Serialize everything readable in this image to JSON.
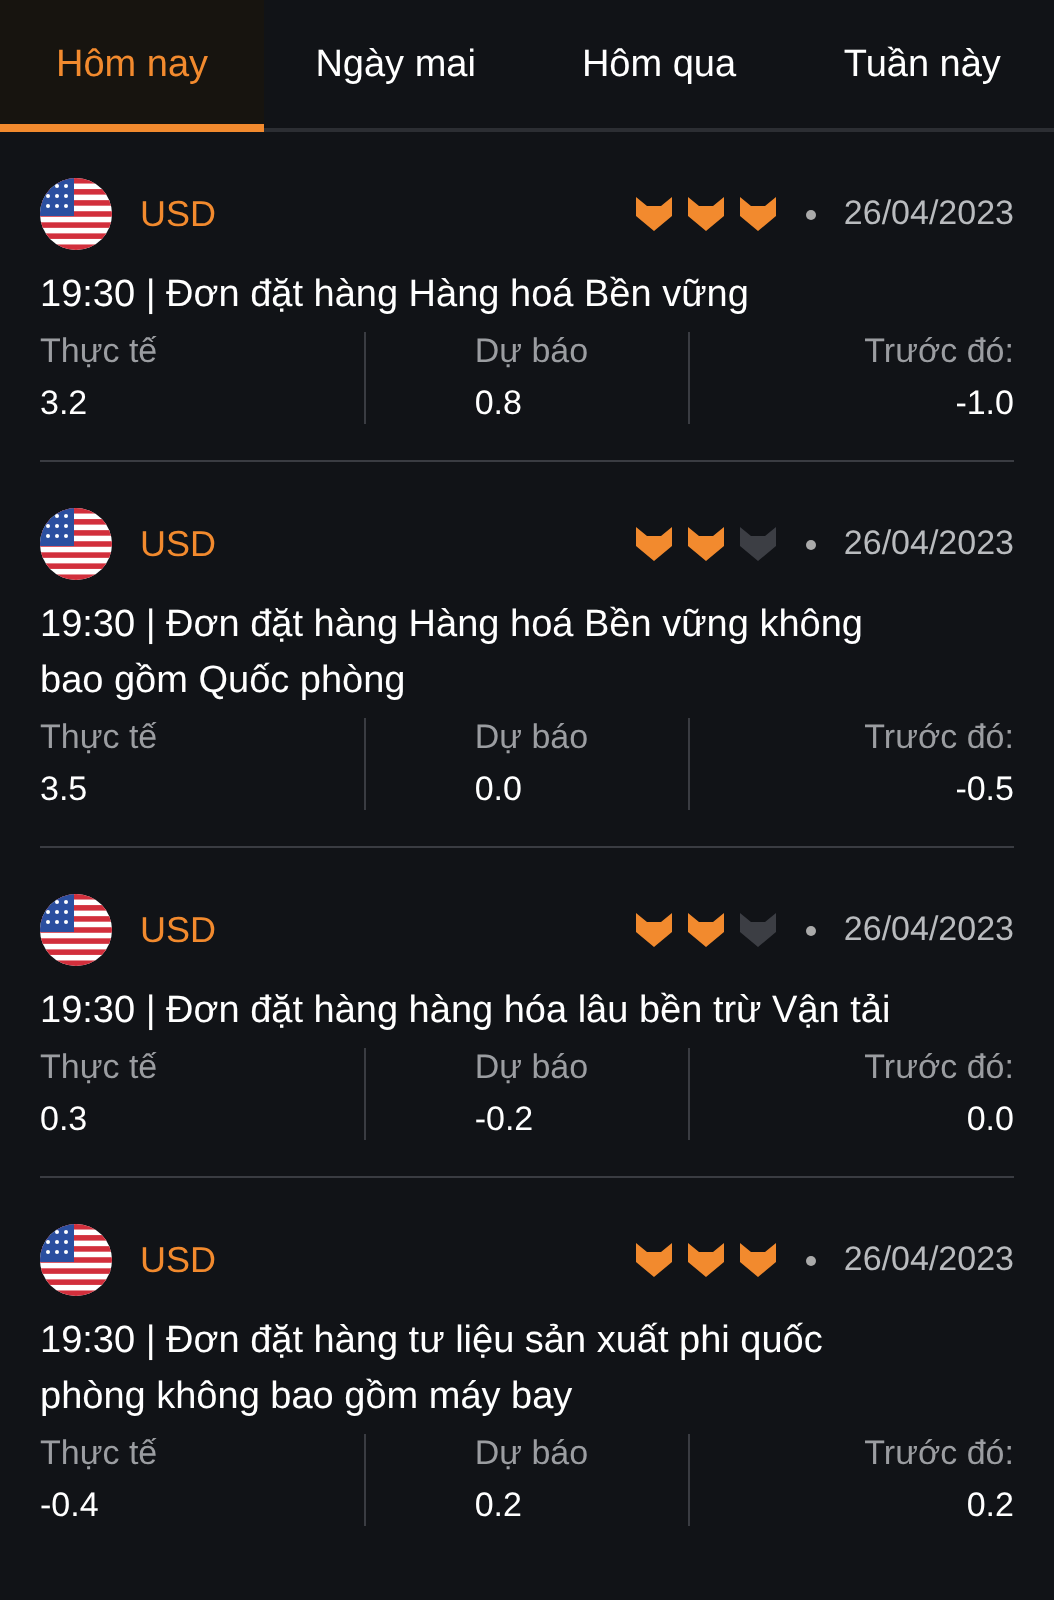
{
  "tabs": [
    {
      "label": "Hôm nay",
      "selected": true
    },
    {
      "label": "Ngày mai",
      "selected": false
    },
    {
      "label": "Hôm qua",
      "selected": false
    },
    {
      "label": "Tuần này",
      "selected": false
    }
  ],
  "events": [
    {
      "currency": "USD",
      "stars": 3,
      "date": "26/04/2023",
      "title": "19:30 | Đơn đặt hàng Hàng hoá Bền vững",
      "stats": [
        {
          "label": "Thực tế",
          "value": "3.2"
        },
        {
          "label": "Dự báo",
          "value": "0.8"
        },
        {
          "label": "Trước đó:",
          "value": "-1.0"
        }
      ]
    },
    {
      "currency": "USD",
      "stars": 2,
      "date": "26/04/2023",
      "title": "19:30 | Đơn đặt hàng Hàng hoá Bền vững không bao gồm Quốc phòng",
      "stats": [
        {
          "label": "Thực tế",
          "value": "3.5"
        },
        {
          "label": "Dự báo",
          "value": "0.0"
        },
        {
          "label": "Trước đó:",
          "value": "-0.5"
        }
      ]
    },
    {
      "currency": "USD",
      "stars": 2,
      "date": "26/04/2023",
      "title": "19:30 | Đơn đặt hàng hàng hóa lâu bền trừ Vận tải",
      "stats": [
        {
          "label": "Thực tế",
          "value": "0.3"
        },
        {
          "label": "Dự báo",
          "value": "-0.2"
        },
        {
          "label": "Trước đó:",
          "value": "0.0"
        }
      ]
    },
    {
      "currency": "USD",
      "stars": 3,
      "date": "26/04/2023",
      "title": "19:30 | Đơn đặt hàng tư liệu sản xuất phi quốc phòng không bao gồm máy bay",
      "stats": [
        {
          "label": "Thực tế",
          "value": "-0.4"
        },
        {
          "label": "Dự báo",
          "value": "0.2"
        },
        {
          "label": "Trước đó:",
          "value": "0.2"
        }
      ]
    }
  ]
}
